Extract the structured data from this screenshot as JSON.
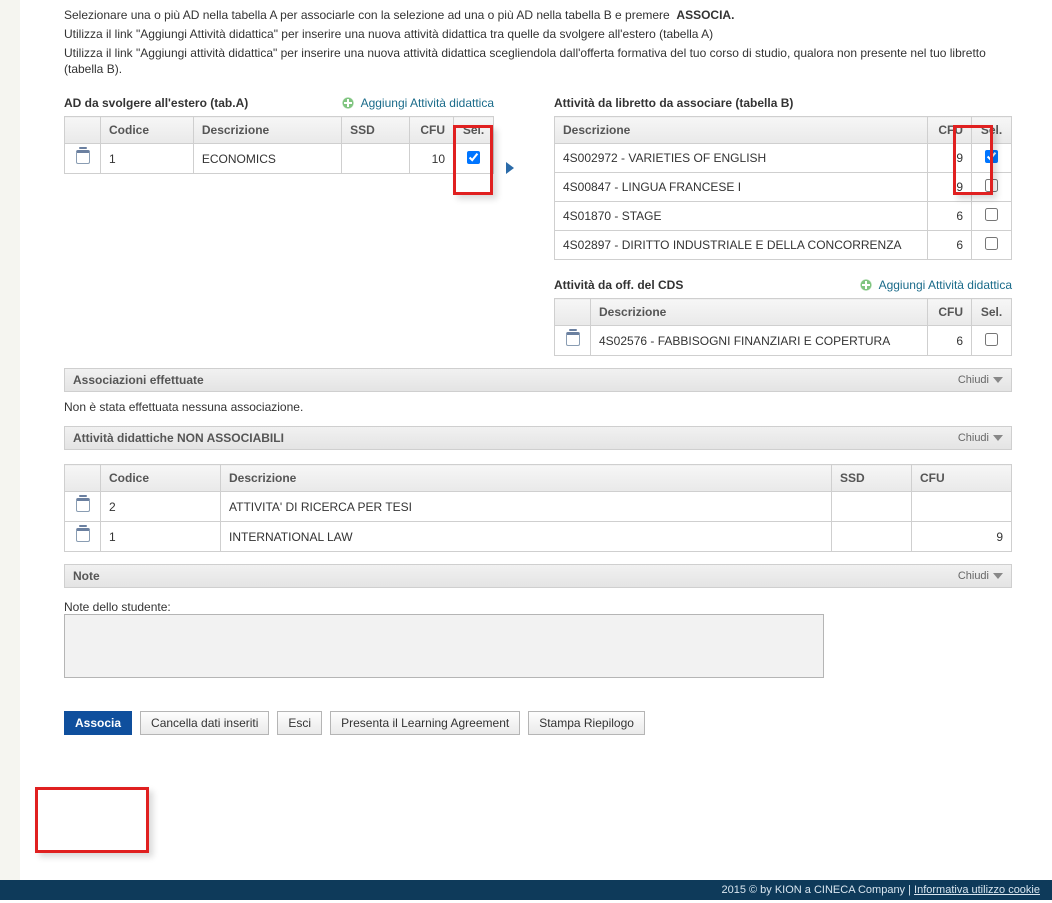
{
  "intro": {
    "line1a": "Selezionare una o più AD nella tabella A per associarle con la selezione ad una o più AD nella tabella B e premere ",
    "line1b": "ASSOCIA.",
    "line2": "Utilizza il link \"Aggiungi Attività didattica\" per inserire una nuova attività didattica tra quelle da svolgere all'estero (tabella A)",
    "line3": "Utilizza il link \"Aggiungi attività didattica\" per inserire una nuova attività didattica scegliendola dall'offerta formativa del tuo corso di studio, qualora non presente nel tuo libretto (tabella B)."
  },
  "tabA": {
    "title": "AD da svolgere all'estero (tab.A)",
    "add": "Aggiungi Attività didattica",
    "cols": {
      "codice": "Codice",
      "descr": "Descrizione",
      "ssd": "SSD",
      "cfu": "CFU",
      "sel": "Sel."
    },
    "rows": [
      {
        "codice": "1",
        "descr": "ECONOMICS",
        "ssd": "",
        "cfu": "10",
        "checked": true
      }
    ]
  },
  "tabB1": {
    "title": "Attività da libretto da associare (tabella B)",
    "cols": {
      "descr": "Descrizione",
      "cfu": "CFU",
      "sel": "Sel."
    },
    "rows": [
      {
        "descr": "4S002972 - VARIETIES OF ENGLISH",
        "cfu": "9",
        "checked": true
      },
      {
        "descr": "4S00847 - LINGUA FRANCESE I",
        "cfu": "9",
        "checked": false
      },
      {
        "descr": "4S01870 - STAGE",
        "cfu": "6",
        "checked": false
      },
      {
        "descr": "4S02897 - DIRITTO INDUSTRIALE E DELLA CONCORRENZA",
        "cfu": "6",
        "checked": false
      }
    ]
  },
  "tabB2": {
    "title": "Attività da off. del CDS",
    "add": "Aggiungi Attività didattica",
    "cols": {
      "descr": "Descrizione",
      "cfu": "CFU",
      "sel": "Sel."
    },
    "rows": [
      {
        "descr": "4S02576 - FABBISOGNI FINANZIARI E COPERTURA",
        "cfu": "6",
        "checked": false
      }
    ]
  },
  "assoc": {
    "title": "Associazioni effettuate",
    "collapse": "Chiudi",
    "none": "Non è stata effettuata nessuna associazione."
  },
  "nonassoc": {
    "title": "Attività didattiche NON ASSOCIABILI",
    "collapse": "Chiudi",
    "cols": {
      "codice": "Codice",
      "descr": "Descrizione",
      "ssd": "SSD",
      "cfu": "CFU"
    },
    "rows": [
      {
        "codice": "2",
        "descr": "ATTIVITA' DI RICERCA PER TESI",
        "ssd": "",
        "cfu": ""
      },
      {
        "codice": "1",
        "descr": "INTERNATIONAL LAW",
        "ssd": "",
        "cfu": "9"
      }
    ]
  },
  "note": {
    "title": "Note",
    "collapse": "Chiudi",
    "label": "Note dello studente:",
    "value": ""
  },
  "buttons": {
    "associa": "Associa",
    "cancella": "Cancella dati inseriti",
    "esci": "Esci",
    "presenta": "Presenta il Learning Agreement",
    "stampa": "Stampa Riepilogo"
  },
  "footer": {
    "copyright": "2015 © by KION a CINECA Company",
    "sep": " | ",
    "cookie": "Informativa utilizzo cookie"
  }
}
